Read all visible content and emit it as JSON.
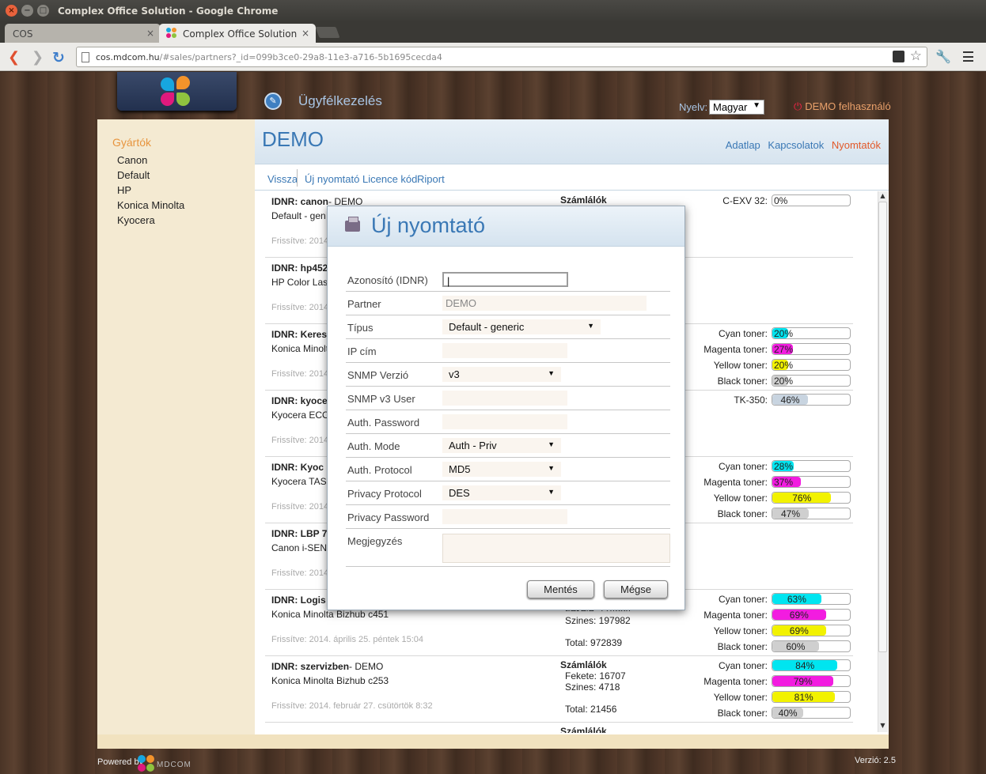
{
  "browser": {
    "window_title": "Complex Office Solution - Google Chrome",
    "tabs": [
      {
        "label": "COS"
      },
      {
        "label": "Complex Office Solution"
      }
    ],
    "url_host": "cos.mdcom.hu",
    "url_path": "/#sales/partners?_id=099b3ce0-29a8-11e3-a716-5b1695cecda4"
  },
  "header": {
    "app_title": "Ügyfélkezelés",
    "lang_label": "Nyelv:",
    "lang_value": "Magyar",
    "user": "DEMO felhasználó"
  },
  "sidebar": {
    "heading": "Gyártók",
    "items": [
      "Canon",
      "Default",
      "HP",
      "Konica Minolta",
      "Kyocera"
    ]
  },
  "main": {
    "title": "DEMO",
    "links": [
      "Adatlap",
      "Kapcsolatok",
      "Nyomtatók"
    ],
    "subnav": [
      "Vissza",
      "Új nyomtató",
      "Licence kód",
      "Riport"
    ]
  },
  "printers": [
    {
      "idnr": "canon",
      "suffix": "- DEMO",
      "model": "Default - gen",
      "updated": "Frissítve: 2014"
    },
    {
      "idnr": "hp452",
      "suffix": "",
      "model": "HP Color Las",
      "updated": "Frissítve: 2014"
    },
    {
      "idnr": "Keres",
      "suffix": "",
      "model": "Konica Minolt",
      "updated": "Frissítve: 2014"
    },
    {
      "idnr": "kyoce",
      "suffix": "",
      "model": "Kyocera ECO",
      "updated": "Frissítve: 2014"
    },
    {
      "idnr": "Kyoc",
      "suffix": "",
      "model": "Kyocera TAS",
      "updated": "Frissítve: 2014"
    },
    {
      "idnr": "LBP 7",
      "suffix": "",
      "model": "Canon i-SEN",
      "updated": "Frissítve: 2014"
    },
    {
      "idnr": "Logis",
      "suffix": "",
      "model": "Konica Minolta Bizhub c451",
      "updated": "Frissítve: 2014. április 25. péntek 15:04"
    },
    {
      "idnr": "szervizben",
      "suffix": "- DEMO",
      "model": "Konica Minolta Bizhub c253",
      "updated": "Frissítve: 2014. február 27. csütörtök 8:32"
    }
  ],
  "counters": {
    "heading": "Számlálók",
    "row7_partial": "Fekete: 774884",
    "row7_color": "Szines: 197982",
    "row7_total": "Total: 972839",
    "row8_black": "Fekete: 16707",
    "row8_color": "Szines: 4718",
    "row8_total": "Total: 21456",
    "row9_heading": "Számlálók"
  },
  "toners": {
    "cexv": {
      "label": "C-EXV 32:",
      "pct": "0%",
      "value": 0
    },
    "row3": [
      {
        "label": "Cyan toner:",
        "pct": "20%",
        "value": 20,
        "color": "#00e5f0"
      },
      {
        "label": "Magenta toner:",
        "pct": "27%",
        "value": 27,
        "color": "#f21ce0"
      },
      {
        "label": "Yellow toner:",
        "pct": "20%",
        "value": 20,
        "color": "#f2f200"
      },
      {
        "label": "Black toner:",
        "pct": "20%",
        "value": 20,
        "color": "#cfcfcf"
      }
    ],
    "tk": {
      "label": "TK-350:",
      "pct": "46%",
      "value": 46,
      "color": "#c8d4e0"
    },
    "row5": [
      {
        "label": "Cyan toner:",
        "pct": "28%",
        "value": 28,
        "color": "#00e5f0"
      },
      {
        "label": "Magenta toner:",
        "pct": "37%",
        "value": 37,
        "color": "#f21ce0"
      },
      {
        "label": "Yellow toner:",
        "pct": "76%",
        "value": 76,
        "color": "#f2f200"
      },
      {
        "label": "Black toner:",
        "pct": "47%",
        "value": 47,
        "color": "#cfcfcf"
      }
    ],
    "row7": [
      {
        "label": "Cyan toner:",
        "pct": "63%",
        "value": 63,
        "color": "#00e5f0"
      },
      {
        "label": "Magenta toner:",
        "pct": "69%",
        "value": 69,
        "color": "#f21ce0"
      },
      {
        "label": "Yellow toner:",
        "pct": "69%",
        "value": 69,
        "color": "#f2f200"
      },
      {
        "label": "Black toner:",
        "pct": "60%",
        "value": 60,
        "color": "#cfcfcf"
      }
    ],
    "row8": [
      {
        "label": "Cyan toner:",
        "pct": "84%",
        "value": 84,
        "color": "#00e5f0"
      },
      {
        "label": "Magenta toner:",
        "pct": "79%",
        "value": 79,
        "color": "#f21ce0"
      },
      {
        "label": "Yellow toner:",
        "pct": "81%",
        "value": 81,
        "color": "#f2f200"
      },
      {
        "label": "Black toner:",
        "pct": "40%",
        "value": 40,
        "color": "#cfcfcf"
      }
    ]
  },
  "modal": {
    "title": "Új nyomtató",
    "fields": {
      "idnr_label": "Azonosító (IDNR)",
      "partner_label": "Partner",
      "partner_value": "DEMO",
      "type_label": "Típus",
      "type_value": "Default - generic",
      "ip_label": "IP cím",
      "snmp_label": "SNMP Verzió",
      "snmp_value": "v3",
      "snmpuser_label": "SNMP v3 User",
      "authpw_label": "Auth. Password",
      "authmode_label": "Auth. Mode",
      "authmode_value": "Auth - Priv",
      "authproto_label": "Auth. Protocol",
      "authproto_value": "MD5",
      "privproto_label": "Privacy Protocol",
      "privproto_value": "DES",
      "privpw_label": "Privacy Password",
      "note_label": "Megjegyzés"
    },
    "save": "Mentés",
    "cancel": "Mégse"
  },
  "footer": {
    "powered": "Powered by",
    "brand": "MDCOM",
    "version": "Verzió: 2.5"
  }
}
